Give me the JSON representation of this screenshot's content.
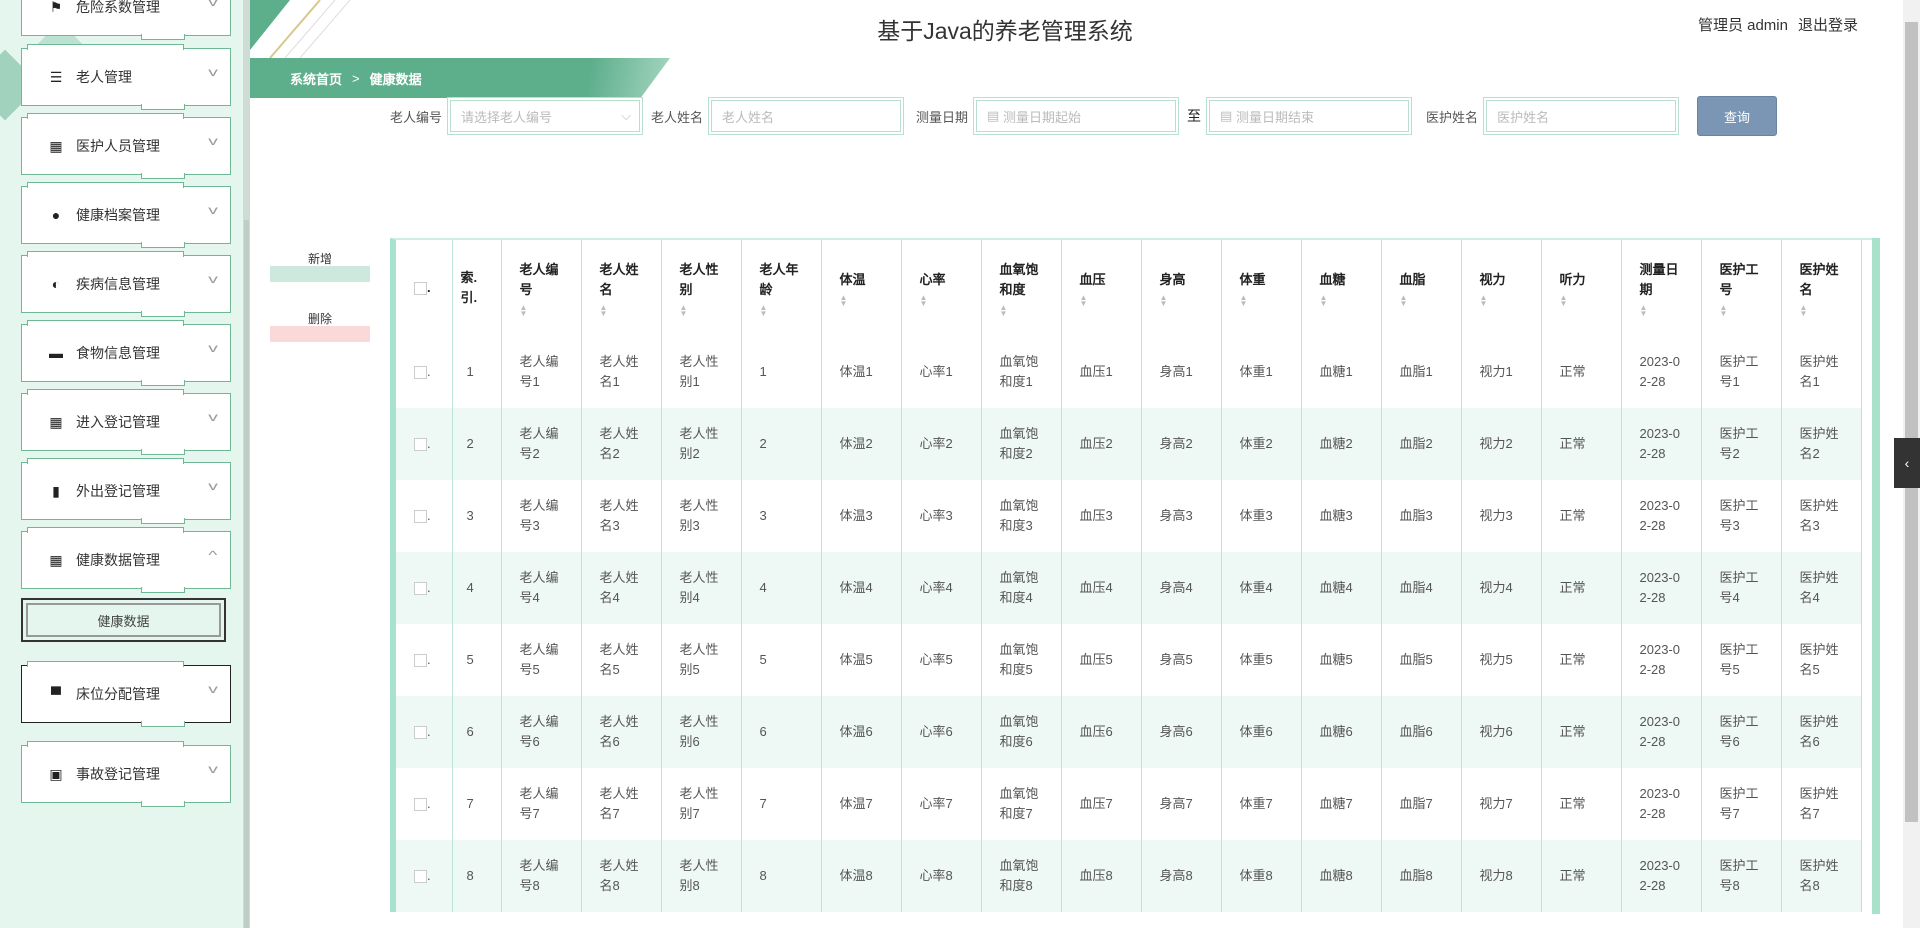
{
  "header": {
    "title": "基于Java的养老管理系统",
    "user": "管理员 admin",
    "logout": "退出登录"
  },
  "breadcrumb": {
    "home": "系统首页",
    "sep": ">",
    "current": "健康数据"
  },
  "sidebar": {
    "items": [
      {
        "label": "危险系数管理",
        "icon": "flag-icon",
        "glyph": "⚑"
      },
      {
        "label": "老人管理",
        "icon": "list-icon",
        "glyph": "☰"
      },
      {
        "label": "医护人员管理",
        "icon": "grid-icon",
        "glyph": "▦"
      },
      {
        "label": "健康档案管理",
        "icon": "user-icon",
        "glyph": "●"
      },
      {
        "label": "疾病信息管理",
        "icon": "bulb-icon",
        "glyph": "◐"
      },
      {
        "label": "食物信息管理",
        "icon": "message-icon",
        "glyph": "▬"
      },
      {
        "label": "进入登记管理",
        "icon": "grid-icon",
        "glyph": "▦"
      },
      {
        "label": "外出登记管理",
        "icon": "book-icon",
        "glyph": "▮"
      },
      {
        "label": "健康数据管理",
        "icon": "grid-icon",
        "glyph": "▦",
        "expanded": true
      },
      {
        "label": "床位分配管理",
        "icon": "bed-icon",
        "glyph": "▀"
      },
      {
        "label": "事故登记管理",
        "icon": "briefcase-icon",
        "glyph": "▣"
      }
    ],
    "sub": "健康数据"
  },
  "search": {
    "elder_no_label": "老人编号",
    "elder_no_placeholder": "请选择老人编号",
    "elder_name_label": "老人姓名",
    "elder_name_placeholder": "老人姓名",
    "date_label": "测量日期",
    "date_start_placeholder": "测量日期起始",
    "to": "至",
    "date_end_placeholder": "测量日期结束",
    "nurse_label": "医护姓名",
    "nurse_placeholder": "医护姓名",
    "query": "查询"
  },
  "actions": {
    "add": "新增",
    "delete": "删除"
  },
  "table": {
    "columns": [
      "索引",
      "老人编号",
      "老人姓名",
      "老人性别",
      "老人年龄",
      "体温",
      "心率",
      "血氧饱和度",
      "血压",
      "身高",
      "体重",
      "血糖",
      "血脂",
      "视力",
      "听力",
      "测量日期",
      "医护工号",
      "医护姓名"
    ],
    "index_header": "索.引.",
    "rows": [
      [
        "1",
        "老人编号1",
        "老人姓名1",
        "老人性别1",
        "1",
        "体温1",
        "心率1",
        "血氧饱和度1",
        "血压1",
        "身高1",
        "体重1",
        "血糖1",
        "血脂1",
        "视力1",
        "正常",
        "2023-02-28",
        "医护工号1",
        "医护姓名1"
      ],
      [
        "2",
        "老人编号2",
        "老人姓名2",
        "老人性别2",
        "2",
        "体温2",
        "心率2",
        "血氧饱和度2",
        "血压2",
        "身高2",
        "体重2",
        "血糖2",
        "血脂2",
        "视力2",
        "正常",
        "2023-02-28",
        "医护工号2",
        "医护姓名2"
      ],
      [
        "3",
        "老人编号3",
        "老人姓名3",
        "老人性别3",
        "3",
        "体温3",
        "心率3",
        "血氧饱和度3",
        "血压3",
        "身高3",
        "体重3",
        "血糖3",
        "血脂3",
        "视力3",
        "正常",
        "2023-02-28",
        "医护工号3",
        "医护姓名3"
      ],
      [
        "4",
        "老人编号4",
        "老人姓名4",
        "老人性别4",
        "4",
        "体温4",
        "心率4",
        "血氧饱和度4",
        "血压4",
        "身高4",
        "体重4",
        "血糖4",
        "血脂4",
        "视力4",
        "正常",
        "2023-02-28",
        "医护工号4",
        "医护姓名4"
      ],
      [
        "5",
        "老人编号5",
        "老人姓名5",
        "老人性别5",
        "5",
        "体温5",
        "心率5",
        "血氧饱和度5",
        "血压5",
        "身高5",
        "体重5",
        "血糖5",
        "血脂5",
        "视力5",
        "正常",
        "2023-02-28",
        "医护工号5",
        "医护姓名5"
      ],
      [
        "6",
        "老人编号6",
        "老人姓名6",
        "老人性别6",
        "6",
        "体温6",
        "心率6",
        "血氧饱和度6",
        "血压6",
        "身高6",
        "体重6",
        "血糖6",
        "血脂6",
        "视力6",
        "正常",
        "2023-02-28",
        "医护工号6",
        "医护姓名6"
      ],
      [
        "7",
        "老人编号7",
        "老人姓名7",
        "老人性别7",
        "7",
        "体温7",
        "心率7",
        "血氧饱和度7",
        "血压7",
        "身高7",
        "体重7",
        "血糖7",
        "血脂7",
        "视力7",
        "正常",
        "2023-02-28",
        "医护工号7",
        "医护姓名7"
      ],
      [
        "8",
        "老人编号8",
        "老人姓名8",
        "老人性别8",
        "8",
        "体温8",
        "心率8",
        "血氧饱和度8",
        "血压8",
        "身高8",
        "体重8",
        "血糖8",
        "血脂8",
        "视力8",
        "正常",
        "2023-02-28",
        "医护工号8",
        "医护姓名8"
      ]
    ]
  },
  "side_tab": "‹"
}
